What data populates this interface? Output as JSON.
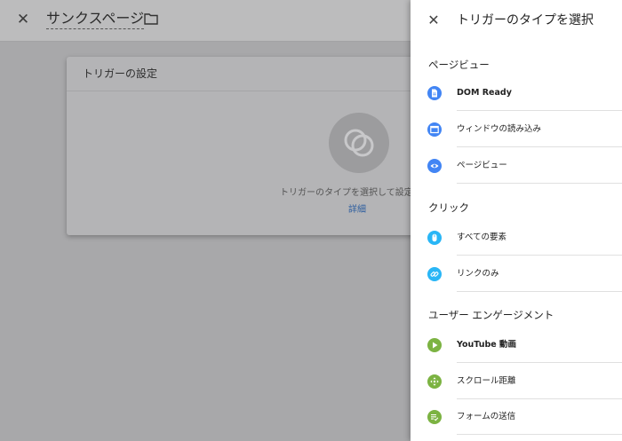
{
  "background": {
    "page_title": "サンクスページ",
    "card": {
      "header": "トリガーの設定",
      "empty_text": "トリガーのタイプを選択して設定を",
      "details_link": "詳細"
    }
  },
  "panel": {
    "title": "トリガーのタイプを選択",
    "sections": [
      {
        "title": "ページビュー",
        "items": [
          {
            "label": "DOM Ready",
            "icon": "document-icon",
            "color": "#4285f4"
          },
          {
            "label": "ウィンドウの読み込み",
            "icon": "window-icon",
            "color": "#4285f4"
          },
          {
            "label": "ページビュー",
            "icon": "eye-icon",
            "color": "#4285f4"
          }
        ]
      },
      {
        "title": "クリック",
        "items": [
          {
            "label": "すべての要素",
            "icon": "mouse-icon",
            "color": "#29b6f6"
          },
          {
            "label": "リンクのみ",
            "icon": "link-icon",
            "color": "#29b6f6"
          }
        ]
      },
      {
        "title": "ユーザー エンゲージメント",
        "items": [
          {
            "label": "YouTube 動画",
            "icon": "play-icon",
            "color": "#7cb342"
          },
          {
            "label": "スクロール距離",
            "icon": "move-arrows-icon",
            "color": "#7cb342"
          },
          {
            "label": "フォームの送信",
            "icon": "form-icon",
            "color": "#7cb342"
          }
        ]
      }
    ]
  }
}
